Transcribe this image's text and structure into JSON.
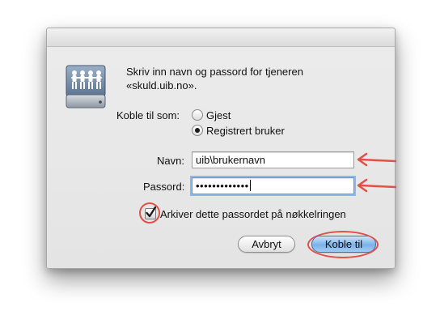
{
  "dialog": {
    "message_line1": "Skriv inn navn og passord for tjeneren",
    "message_line2": "«skuld.uib.no».",
    "icon": "network-server-drive-icon"
  },
  "connect_as": {
    "label": "Koble til som:",
    "options": [
      {
        "label": "Gjest",
        "selected": false
      },
      {
        "label": "Registrert bruker",
        "selected": true
      }
    ]
  },
  "fields": {
    "name_label": "Navn:",
    "name_value": "uib\\brukernavn",
    "password_label": "Passord:",
    "password_value": "•••••••••••••"
  },
  "keychain": {
    "label": "Arkiver dette passordet på nøkkelringen",
    "checked": true
  },
  "buttons": {
    "cancel": "Avbryt",
    "connect": "Koble til"
  },
  "annotations": {
    "color": "#e2504a"
  }
}
